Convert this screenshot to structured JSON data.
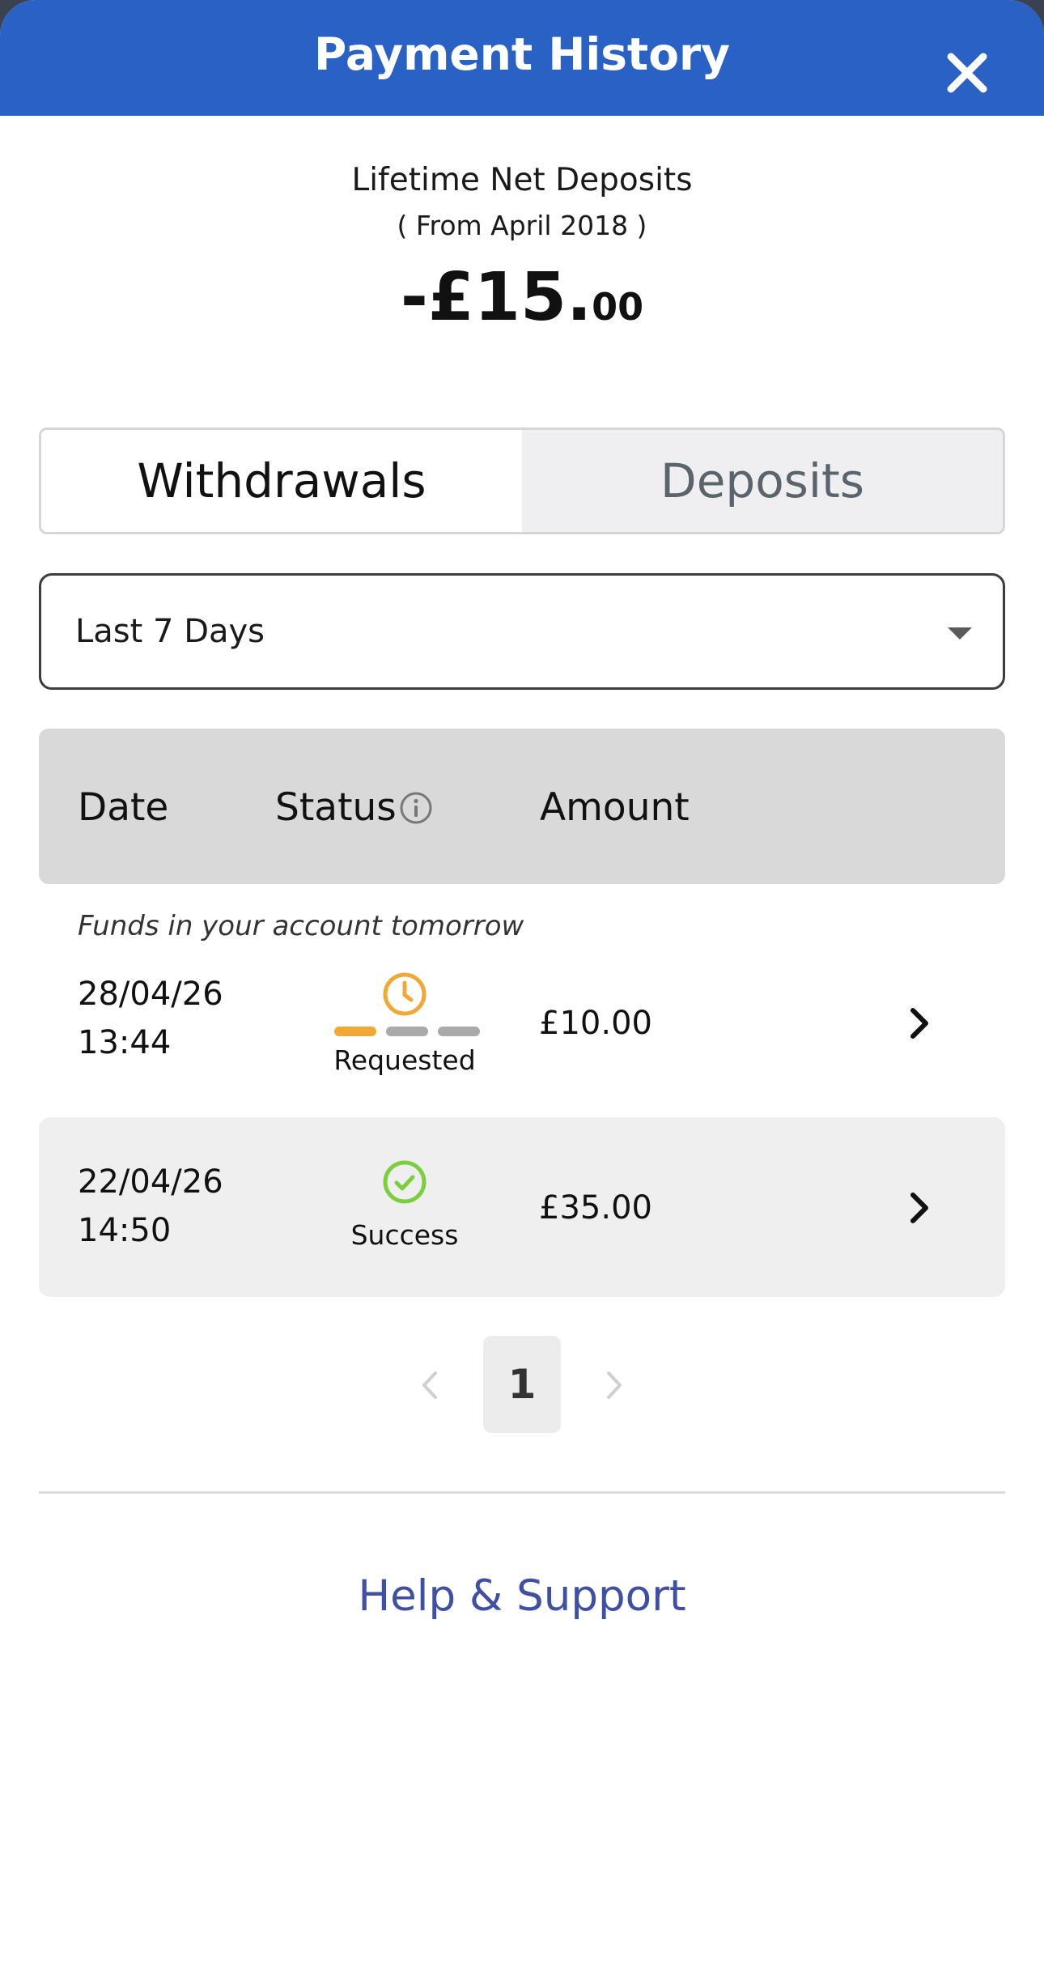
{
  "header": {
    "title": "Payment History",
    "close_icon": "close-icon"
  },
  "summary": {
    "label": "Lifetime Net Deposits",
    "since": "( From April 2018 )",
    "amount_main": "-£15.",
    "amount_decimal": "00"
  },
  "tabs": [
    {
      "label": "Withdrawals",
      "active": true
    },
    {
      "label": "Deposits",
      "active": false
    }
  ],
  "filter": {
    "selected": "Last 7 Days"
  },
  "table": {
    "columns": {
      "date": "Date",
      "status": "Status",
      "amount": "Amount"
    },
    "note": "Funds in your account tomorrow",
    "rows": [
      {
        "date": "28/04/26",
        "time": "13:44",
        "status": "Requested",
        "status_icon": "clock-icon",
        "amount": "£10.00",
        "progress_step": 1,
        "progress_total": 3
      },
      {
        "date": "22/04/26",
        "time": "14:50",
        "status": "Success",
        "status_icon": "check-circle-icon",
        "amount": "£35.00"
      }
    ]
  },
  "pagination": {
    "current_page": "1"
  },
  "footer": {
    "help_link": "Help & Support"
  },
  "colors": {
    "header_bg": "#2a61c4",
    "pending": "#f0a836",
    "success": "#7ccf3c",
    "link": "#3f4fa3"
  }
}
